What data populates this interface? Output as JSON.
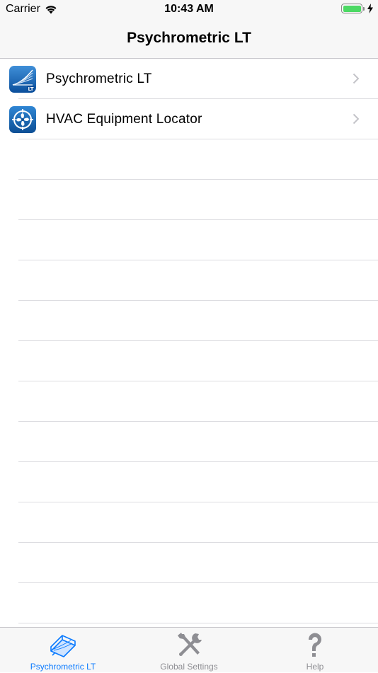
{
  "status_bar": {
    "carrier": "Carrier",
    "time": "10:43 AM",
    "battery_level": 1.0
  },
  "nav": {
    "title": "Psychrometric LT"
  },
  "list": {
    "items": [
      {
        "label": "Psychrometric LT",
        "icon": "psychrometric-lt-app-icon",
        "badge": "LT"
      },
      {
        "label": "HVAC Equipment Locator",
        "icon": "hvac-locator-app-icon"
      }
    ],
    "empty_rows": 12
  },
  "tab_bar": {
    "tabs": [
      {
        "label": "Psychrometric LT",
        "icon": "psychrometric-chart-icon",
        "active": true
      },
      {
        "label": "Global Settings",
        "icon": "tools-icon",
        "active": false
      },
      {
        "label": "Help",
        "icon": "question-mark-icon",
        "active": false
      }
    ]
  },
  "colors": {
    "accent": "#0a7aff",
    "inactive_tab": "#8e8e93",
    "battery": "#4cd964",
    "bar_background": "#f7f7f7",
    "separator": "#dcdce0"
  }
}
